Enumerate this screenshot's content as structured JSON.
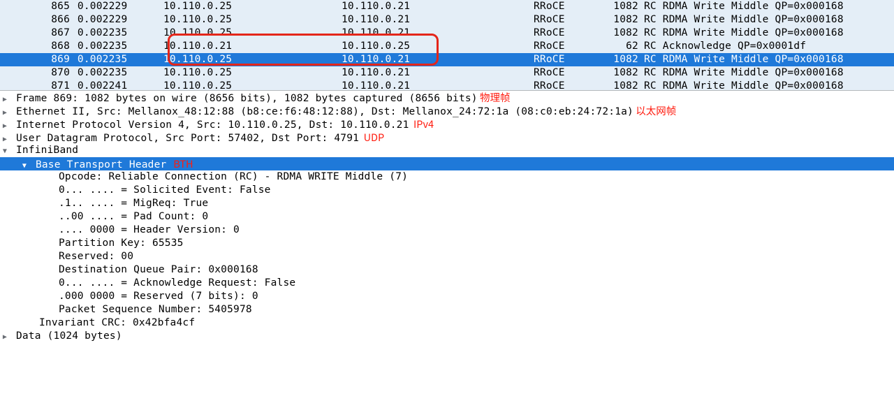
{
  "packets": [
    {
      "no": "865",
      "time": "0.002229",
      "src": "10.110.0.25",
      "dst": "10.110.0.21",
      "proto": "RRoCE",
      "len": "1082",
      "info": "RC RDMA Write Middle QP=0x000168",
      "selected": false
    },
    {
      "no": "866",
      "time": "0.002229",
      "src": "10.110.0.25",
      "dst": "10.110.0.21",
      "proto": "RRoCE",
      "len": "1082",
      "info": "RC RDMA Write Middle QP=0x000168",
      "selected": false
    },
    {
      "no": "867",
      "time": "0.002235",
      "src": "10.110.0.25",
      "dst": "10.110.0.21",
      "proto": "RRoCE",
      "len": "1082",
      "info": "RC RDMA Write Middle QP=0x000168",
      "selected": false
    },
    {
      "no": "868",
      "time": "0.002235",
      "src": "10.110.0.21",
      "dst": "10.110.0.25",
      "proto": "RRoCE",
      "len": "62",
      "info": "RC Acknowledge QP=0x0001df",
      "selected": false
    },
    {
      "no": "869",
      "time": "0.002235",
      "src": "10.110.0.25",
      "dst": "10.110.0.21",
      "proto": "RRoCE",
      "len": "1082",
      "info": "RC RDMA Write Middle QP=0x000168",
      "selected": true
    },
    {
      "no": "870",
      "time": "0.002235",
      "src": "10.110.0.25",
      "dst": "10.110.0.21",
      "proto": "RRoCE",
      "len": "1082",
      "info": "RC RDMA Write Middle QP=0x000168",
      "selected": false
    },
    {
      "no": "871",
      "time": "0.002241",
      "src": "10.110.0.25",
      "dst": "10.110.0.21",
      "proto": "RRoCE",
      "len": "1082",
      "info": "RC RDMA Write Middle QP=0x000168",
      "selected": false
    }
  ],
  "detail": {
    "frame": "Frame 869: 1082 bytes on wire (8656 bits), 1082 bytes captured (8656 bits)",
    "frame_anno": " 物理帧",
    "eth": "Ethernet II, Src: Mellanox_48:12:88 (b8:ce:f6:48:12:88), Dst: Mellanox_24:72:1a (08:c0:eb:24:72:1a)",
    "eth_anno": " 以太网帧",
    "ip": "Internet Protocol Version 4, Src: 10.110.0.25, Dst: 10.110.0.21",
    "ip_anno": "  IPv4",
    "udp": "User Datagram Protocol, Src Port: 57402, Dst Port: 4791",
    "udp_anno": "  UDP",
    "ib": "InfiniBand",
    "bth": "Base Transport Header",
    "bth_anno": "   BTH",
    "bth_fields": [
      "Opcode: Reliable Connection (RC) - RDMA WRITE Middle (7)",
      "0... .... = Solicited Event: False",
      ".1.. .... = MigReq: True",
      "..00 .... = Pad Count: 0",
      ".... 0000 = Header Version: 0",
      "Partition Key: 65535",
      "Reserved: 00",
      "Destination Queue Pair: 0x000168",
      "0... .... = Acknowledge Request: False",
      ".000 0000 = Reserved (7 bits): 0",
      "Packet Sequence Number: 5405978"
    ],
    "invcrc": "Invariant CRC: 0x42bfa4cf",
    "data": "Data (1024 bytes)"
  }
}
